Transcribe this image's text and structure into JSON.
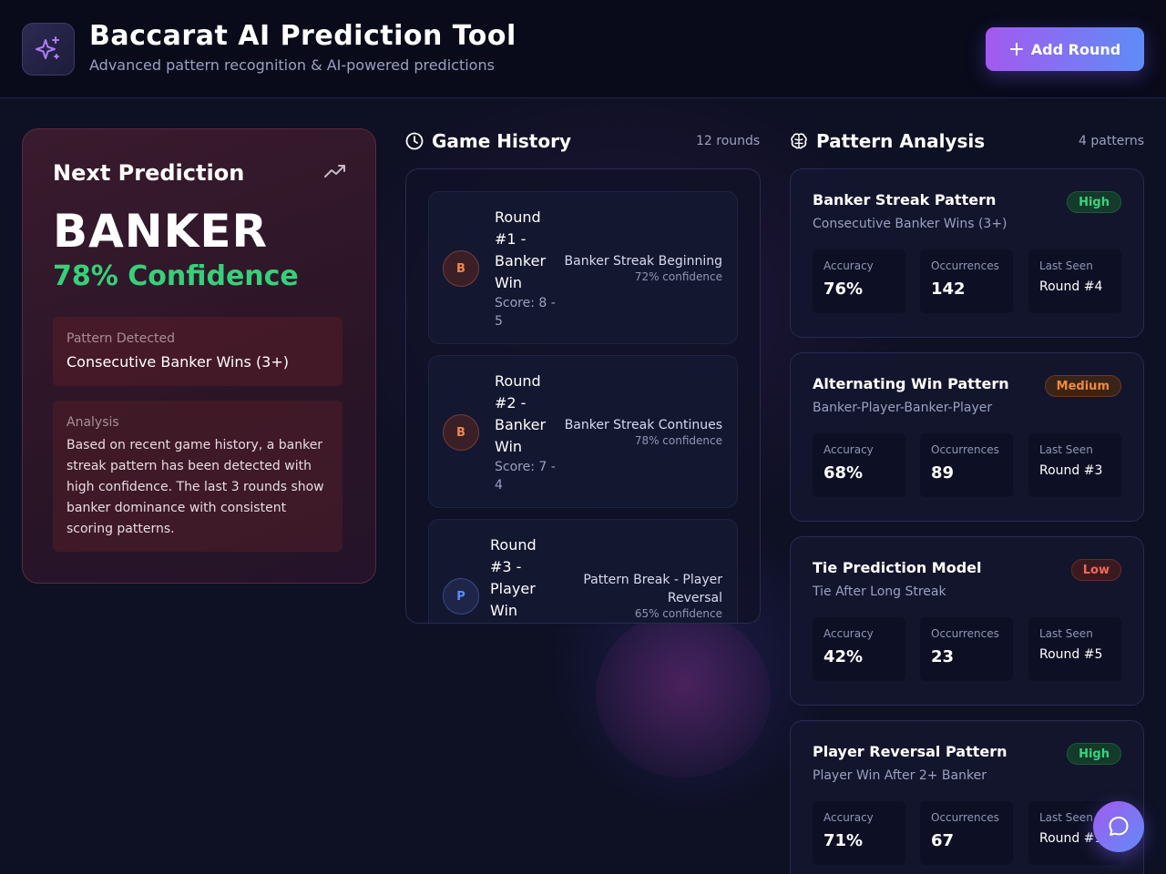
{
  "header": {
    "title": "Baccarat AI Prediction Tool",
    "subtitle": "Advanced pattern recognition & AI-powered predictions",
    "logo_icon": "sparkles-icon",
    "add_round_label": "Add Round"
  },
  "prediction": {
    "heading": "Next Prediction",
    "value": "BANKER",
    "confidence": "78% Confidence",
    "pattern_label": "Pattern Detected",
    "pattern_value": "Consecutive Banker Wins (3+)",
    "analysis_label": "Analysis",
    "analysis_text": "Based on recent game history, a banker streak pattern has been detected with high confidence. The last 3 rounds show banker dominance with consistent scoring patterns."
  },
  "history": {
    "heading": "Game History",
    "count": "12 rounds",
    "rounds": [
      {
        "badge": "B",
        "title": "Round #1 - Banker Win",
        "score": "Score: 8 - 5",
        "pattern": "Banker Streak Beginning",
        "confidence": "72% confidence"
      },
      {
        "badge": "B",
        "title": "Round #2 - Banker Win",
        "score": "Score: 7 - 4",
        "pattern": "Banker Streak Continues",
        "confidence": "78% confidence"
      },
      {
        "badge": "P",
        "title": "Round #3 - Player Win",
        "score": "",
        "pattern": "Pattern Break - Player Reversal",
        "confidence": "65% confidence"
      }
    ]
  },
  "patterns": {
    "heading": "Pattern Analysis",
    "count": "4 patterns",
    "stat_labels": {
      "accuracy": "Accuracy",
      "occurrences": "Occurrences",
      "last_seen": "Last Seen"
    },
    "items": [
      {
        "name": "Banker Streak Pattern",
        "desc": "Consecutive Banker Wins (3+)",
        "level": "High",
        "accuracy": "76%",
        "occurrences": "142",
        "last_seen": "Round #4"
      },
      {
        "name": "Alternating Win Pattern",
        "desc": "Banker-Player-Banker-Player",
        "level": "Medium",
        "accuracy": "68%",
        "occurrences": "89",
        "last_seen": "Round #3"
      },
      {
        "name": "Tie Prediction Model",
        "desc": "Tie After Long Streak",
        "level": "Low",
        "accuracy": "42%",
        "occurrences": "23",
        "last_seen": "Round #5"
      },
      {
        "name": "Player Reversal Pattern",
        "desc": "Player Win After 2+ Banker",
        "level": "High",
        "accuracy": "71%",
        "occurrences": "67",
        "last_seen": "Round #1"
      }
    ]
  },
  "colors": {
    "banker": "#f0874a",
    "player": "#5b8cff",
    "confidence": "#37d07a",
    "accent_start": "#a35af0",
    "accent_end": "#5f8cf6"
  }
}
